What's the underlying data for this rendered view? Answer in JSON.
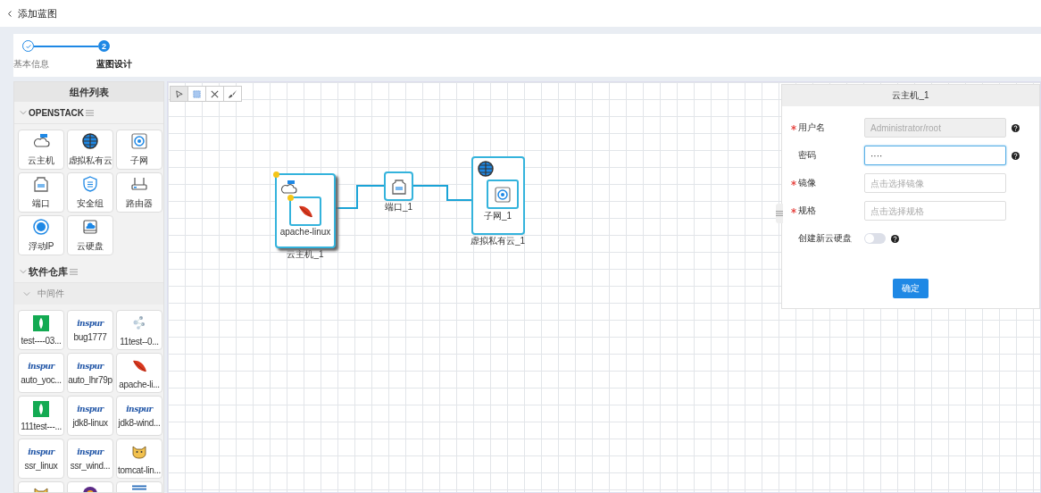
{
  "page_title": "添加蓝图",
  "steps": [
    {
      "label": "基本信息",
      "done": true,
      "selected": false
    },
    {
      "label": "蓝图设计",
      "number": "2",
      "done": false,
      "selected": true
    }
  ],
  "components": {
    "title": "组件列表",
    "sections": [
      {
        "title": "OPENSTACK",
        "expanded": true,
        "items": [
          {
            "label": "云主机"
          },
          {
            "label": "虚拟私有云"
          },
          {
            "label": "子网"
          },
          {
            "label": "端口"
          },
          {
            "label": "安全组"
          },
          {
            "label": "路由器"
          },
          {
            "label": "浮动IP"
          },
          {
            "label": "云硬盘"
          }
        ]
      },
      {
        "title": "软件仓库",
        "expanded": true,
        "subsections": [
          {
            "title": "中间件",
            "expanded": true
          }
        ],
        "items": [
          {
            "label": "test----03..."
          },
          {
            "label": "bug1777",
            "logo": "inspur"
          },
          {
            "label": "11test--0..."
          },
          {
            "label": "auto_yoc...",
            "logo": "inspur"
          },
          {
            "label": "auto_lhr79p",
            "logo": "inspur"
          },
          {
            "label": "apache-li..."
          },
          {
            "label": "111test---..."
          },
          {
            "label": "jdk8-linux",
            "logo": "inspur"
          },
          {
            "label": "jdk8-wind...",
            "logo": "inspur"
          },
          {
            "label": "ssr_linux",
            "logo": "inspur"
          },
          {
            "label": "ssr_wind...",
            "logo": "inspur"
          },
          {
            "label": "tomcat-lin..."
          },
          {
            "kind": "partial"
          },
          {
            "kind": "partial"
          },
          {
            "kind": "partial"
          }
        ]
      }
    ]
  },
  "toolbar": [
    {
      "selected": true
    },
    {
      "selected": false
    },
    {
      "selected": false
    },
    {
      "selected": false
    }
  ],
  "canvas": {
    "nodes": [
      {
        "kind": "server",
        "name": "云主机_1",
        "selected": true,
        "inner_label": "apache-linux"
      },
      {
        "kind": "port",
        "name": "端口_1",
        "selected": false
      },
      {
        "kind": "network",
        "name": "虚拟私有云_1",
        "selected": false,
        "inner_label": "子网_1"
      }
    ]
  },
  "properties": {
    "title": "云主机_1",
    "fields": [
      {
        "kind": "input",
        "label": "用户名",
        "required": true,
        "disabled": true,
        "focused": false,
        "value": "Administrator/root",
        "help": true
      },
      {
        "kind": "input",
        "label": "密码",
        "required": false,
        "disabled": false,
        "focused": true,
        "value": "····",
        "help": true
      },
      {
        "kind": "input",
        "label": "镜像",
        "required": true,
        "disabled": false,
        "focused": false,
        "placeholder": "点击选择镜像",
        "help": false
      },
      {
        "kind": "input",
        "label": "规格",
        "required": true,
        "disabled": false,
        "focused": false,
        "placeholder": "点击选择规格",
        "help": false
      },
      {
        "kind": "toggle",
        "label": "创建新云硬盘",
        "required": false,
        "on": false,
        "help": true
      }
    ],
    "confirm": "确定"
  }
}
